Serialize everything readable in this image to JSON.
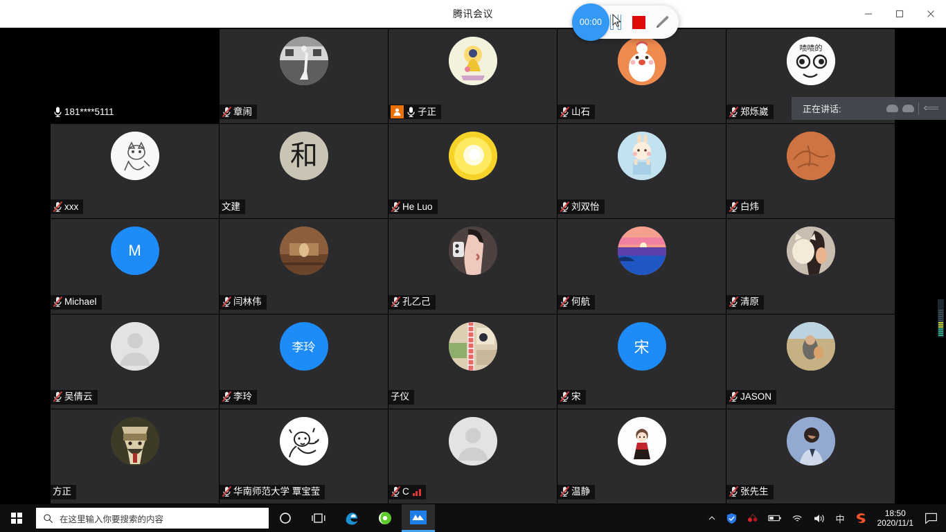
{
  "window": {
    "title": "腾讯会议",
    "minimize_label": "最小化",
    "maximize_label": "最大化",
    "close_label": "关闭"
  },
  "recorder": {
    "timer": "00:00",
    "pause_label": "pause-recording",
    "stop_label": "stop-recording",
    "pen_label": "annotate"
  },
  "speaking_tip": {
    "label": "正在讲话:"
  },
  "grid": {
    "columns": 5,
    "rows": 5,
    "participants": [
      {
        "name": "181****5111",
        "mic": "on",
        "avatar": "none",
        "avatar_color": "#000000",
        "initial": "",
        "blank": true,
        "host": false
      },
      {
        "name": "章闹",
        "mic": "muted",
        "avatar": "photo-bw-woman",
        "avatar_color": "#b9b9b9",
        "initial": "",
        "blank": false,
        "host": false
      },
      {
        "name": "子正",
        "mic": "on",
        "avatar": "buddha",
        "avatar_color": "#eeeedd",
        "initial": "",
        "blank": false,
        "host": true
      },
      {
        "name": "山石",
        "mic": "muted",
        "avatar": "bunny",
        "avatar_color": "#ef8b4f",
        "initial": "",
        "blank": false,
        "host": false
      },
      {
        "name": "郑烁崴",
        "mic": "muted",
        "avatar": "meme-face",
        "avatar_color": "#f2f2f2",
        "initial": "",
        "blank": false,
        "host": false
      },
      {
        "name": "xxx",
        "mic": "muted",
        "avatar": "sketch-cat",
        "avatar_color": "#f4f4f4",
        "initial": "",
        "blank": false,
        "host": false
      },
      {
        "name": "文建",
        "mic": "none",
        "avatar": "calligraphy-he",
        "avatar_color": "#bdb9ab",
        "initial": "",
        "blank": false,
        "host": false
      },
      {
        "name": "He Luo",
        "mic": "muted",
        "avatar": "yellow-orb",
        "avatar_color": "#ffe23a",
        "initial": "",
        "blank": false,
        "host": false
      },
      {
        "name": "刘双怡",
        "mic": "muted",
        "avatar": "baby-bunny",
        "avatar_color": "#bfe0ef",
        "initial": "",
        "blank": false,
        "host": false
      },
      {
        "name": "白炜",
        "mic": "muted",
        "avatar": "clay-brown",
        "avatar_color": "#cd7442",
        "initial": "",
        "blank": false,
        "host": false
      },
      {
        "name": "Michael",
        "mic": "muted",
        "avatar": "initial",
        "avatar_color": "#1d8cf8",
        "initial": "M",
        "blank": false,
        "host": false
      },
      {
        "name": "闫林伟",
        "mic": "muted",
        "avatar": "sepia-scene",
        "avatar_color": "#9c6a45",
        "initial": "",
        "blank": false,
        "host": false
      },
      {
        "name": "孔乙己",
        "mic": "muted",
        "avatar": "selfie-mirror",
        "avatar_color": "#6b5a56",
        "initial": "",
        "blank": false,
        "host": false
      },
      {
        "name": "何航",
        "mic": "muted",
        "avatar": "sunset-sea",
        "avatar_color": "#f2a0a0",
        "initial": "",
        "blank": false,
        "host": false
      },
      {
        "name": "清原",
        "mic": "muted",
        "avatar": "cat-hug",
        "avatar_color": "#d9cfc3",
        "initial": "",
        "blank": false,
        "host": false
      },
      {
        "name": "吴倩云",
        "mic": "muted",
        "avatar": "default-person",
        "avatar_color": "#e3e3e3",
        "initial": "",
        "blank": false,
        "host": false
      },
      {
        "name": "李玲",
        "mic": "muted",
        "avatar": "initial",
        "avatar_color": "#1d8cf8",
        "initial": "李玲",
        "blank": false,
        "host": false
      },
      {
        "name": "子仪",
        "mic": "none",
        "avatar": "collage",
        "avatar_color": "#d9c6a8",
        "initial": "",
        "blank": false,
        "host": false
      },
      {
        "name": "宋",
        "mic": "muted",
        "avatar": "initial",
        "avatar_color": "#1d8cf8",
        "initial": "宋",
        "blank": false,
        "host": false
      },
      {
        "name": "JASON",
        "mic": "muted",
        "avatar": "outdoor-photo",
        "avatar_color": "#c3b79a",
        "initial": "",
        "blank": false,
        "host": false
      },
      {
        "name": "方正",
        "mic": "none",
        "avatar": "wood-mask",
        "avatar_color": "#8d7b55",
        "initial": "",
        "blank": false,
        "host": false
      },
      {
        "name": "华南师范大学 覃宝莹",
        "mic": "muted",
        "avatar": "sketch-bear",
        "avatar_color": "#ffffff",
        "initial": "",
        "blank": false,
        "host": false
      },
      {
        "name": "C",
        "mic": "muted",
        "avatar": "default-person",
        "avatar_color": "#e3e3e3",
        "initial": "",
        "blank": false,
        "host": false,
        "network": "weak"
      },
      {
        "name": "温静",
        "mic": "muted",
        "avatar": "doll-girl",
        "avatar_color": "#ffffff",
        "initial": "",
        "blank": false,
        "host": false
      },
      {
        "name": "张先生",
        "mic": "muted",
        "avatar": "portrait-blue",
        "avatar_color": "#8fa4c8",
        "initial": "",
        "blank": false,
        "host": false
      }
    ]
  },
  "taskbar": {
    "start_label": "开始",
    "search_placeholder": "在这里输入你要搜索的内容",
    "cortana_label": "Cortana",
    "taskview_label": "任务视图",
    "edge_label": "Microsoft Edge",
    "browser_label": "浏览器",
    "meeting_app_label": "腾讯会议",
    "tray": {
      "chevron_label": "显示隐藏的图标",
      "security_label": "腾讯电脑管家",
      "cherry_label": "应用图标",
      "battery_label": "电池",
      "wifi_label": "网络",
      "volume_label": "音量",
      "ime_label": "中",
      "sogou_label": "搜狗输入法"
    },
    "clock": {
      "time": "18:50",
      "date": "2020/11/1"
    },
    "notification_label": "操作中心"
  },
  "colors": {
    "accent_blue": "#1d8cf8",
    "record_red": "#e00a0a",
    "host_orange": "#e8710a",
    "tile_bg": "#2b2b2d",
    "muted_red": "#d03c3c"
  }
}
